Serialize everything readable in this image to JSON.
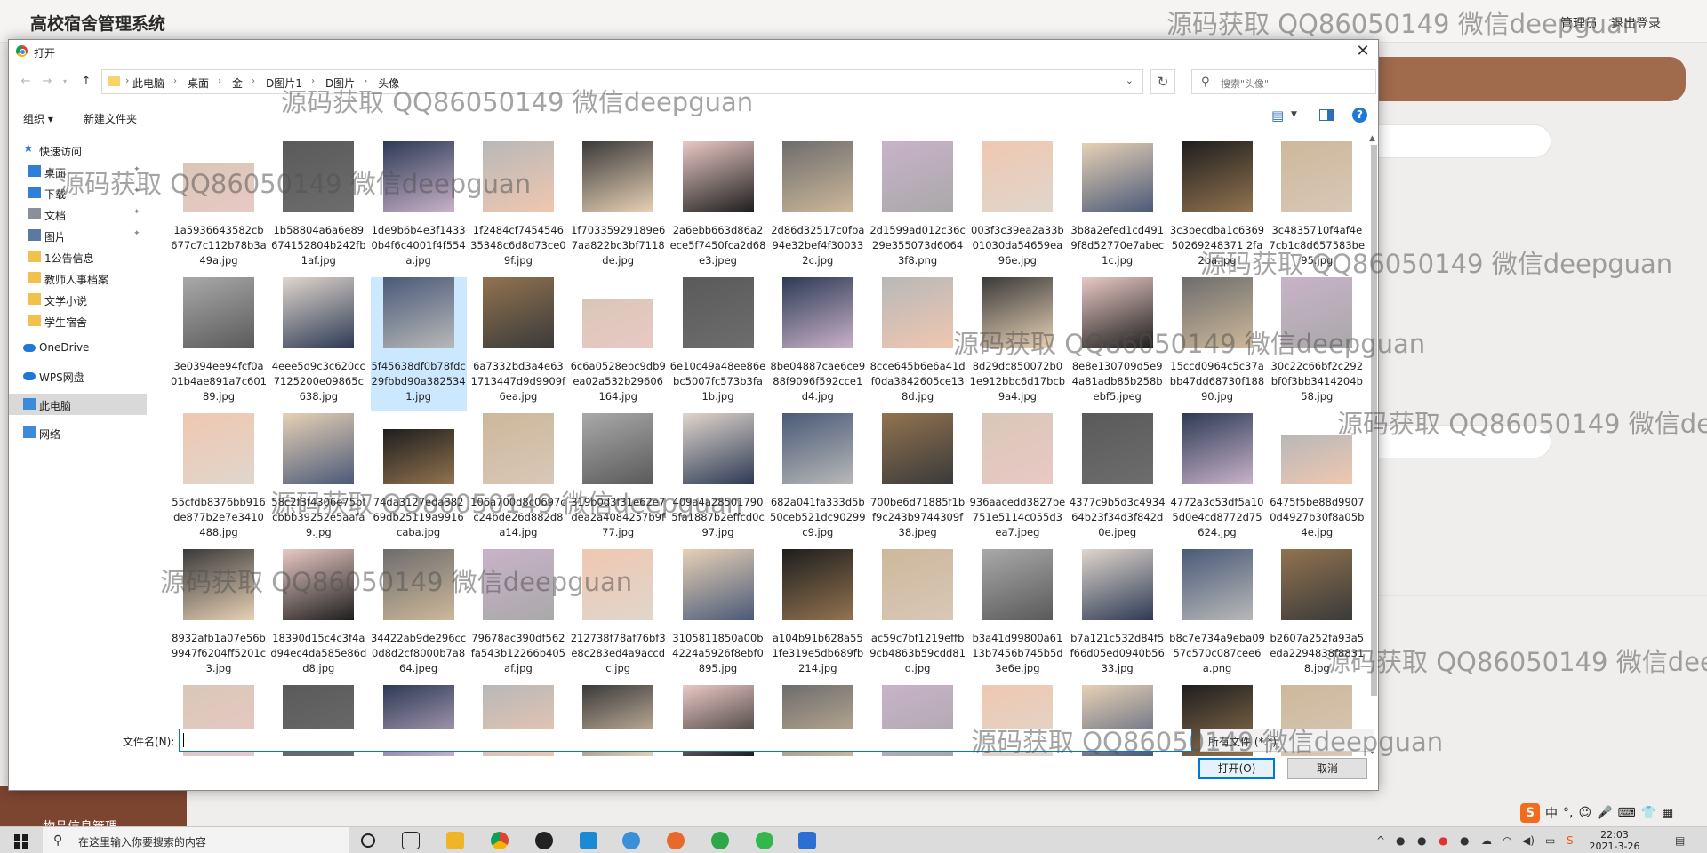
{
  "app": {
    "title": "高校宿舍管理系统",
    "user": "管理员",
    "logout": "退出登录",
    "side_label": "物品信息管理",
    "accent": "#a06a4c"
  },
  "watermark": "源码获取 QQ86050149 微信deepguan",
  "dialog": {
    "title": "打开",
    "close": "✕",
    "breadcrumbs": [
      "此电脑",
      "桌面",
      "金",
      "D图片1",
      "D图片",
      "头像"
    ],
    "search_placeholder": "搜索\"头像\"",
    "toolbar": {
      "organize": "组织 ▾",
      "new_folder": "新建文件夹"
    },
    "nav": [
      {
        "label": "快速访问",
        "icon": "star-icon",
        "pinned": false
      },
      {
        "label": "桌面",
        "icon": "desktop-icon",
        "pinned": true
      },
      {
        "label": "下载",
        "icon": "download-icon",
        "pinned": true
      },
      {
        "label": "文档",
        "icon": "document-icon",
        "pinned": true
      },
      {
        "label": "图片",
        "icon": "picture-icon",
        "pinned": true
      },
      {
        "label": "1公告信息",
        "icon": "folder-icon",
        "pinned": false
      },
      {
        "label": "教师人事档案",
        "icon": "folder-icon",
        "pinned": false
      },
      {
        "label": "文学小说",
        "icon": "folder-icon",
        "pinned": false
      },
      {
        "label": "学生宿舍",
        "icon": "folder-icon",
        "pinned": false
      },
      {
        "label": "OneDrive",
        "icon": "cloud-icon",
        "pinned": false
      },
      {
        "label": "WPS网盘",
        "icon": "cloud-icon",
        "pinned": false
      },
      {
        "label": "此电脑",
        "icon": "computer-icon",
        "pinned": false
      },
      {
        "label": "网络",
        "icon": "network-icon",
        "pinned": false
      }
    ],
    "files": [
      [
        "1a5936643582cb677c7c112b78b3a49a.jpg",
        "1b58804a6a6e89674152804b242fb1af.jpg",
        "1de9b6b4e3f14330b4f6c4001f4f554a.jpg",
        "1f2484cf745454635348c6d8d73ce09f.jpg",
        "1f70335929189e67aa822bc3bf7118de.jpg",
        "2a6ebb663d86a2ece5f7450fca2d68e3.jpeg",
        "2d86d32517c0fba94e32bef4f300332c.jpg",
        "2d1599ad012c36c29e355073d60643f8.png",
        "003f3c39ea2a33b01030da54659ea96e.jpg",
        "3b8a2efed1cd4919f8d52770e7abec1c.jpg",
        "3c3becdba1c636950269248371 2fa2ba.jpg",
        "3c4835710f4af4e7cb1c8d657583be95.jpg"
      ],
      [
        "3e0394ee94fcf0a01b4ae891a7c60189.jpg",
        "4eee5d9c3c620cc7125200e09865c638.jpg",
        "5f45638df0b78fdc29fbbd90a3825341.jpg",
        "6a7332bd3a4e631713447d9d9909f6ea.jpg",
        "6c6a0528ebc9db9ea02a532b29606164.jpg",
        "6e10c49a48ee86ebc5007fc573b3fa1b.jpg",
        "8be04887cae6ce988f9096f592cce1d4.jpg",
        "8cce645b6e6a41df0da3842605ce138d.jpg",
        "8d29dc850072b01e912bbc6d17bcb9a4.jpg",
        "8e8e130709d5e94a81adb85b258bebf5.jpeg",
        "15ccd0964c5c37abb47dd68730f18890.jpg",
        "30c22c66bf2c292bf0f3bb3414204b58.jpg"
      ],
      [
        "55cfdb8376bb916de877b2e7e3410488.jpg",
        "58c2f3f4306e75bfcbbb39252e5aafa9.jpg",
        "74da3127eda38269db25119a9916caba.jpg",
        "106a700d8c0697cc24bde26d882d8a14.jpg",
        "319b0d3f31e62e7dea2a4084257b9f77.jpg",
        "409a4a285017905fa1887b2effcd0c97.jpg",
        "682a041fa333d5b50ceb521dc90299c9.jpg",
        "700be6d71885f1bf9c243b9744309f38.jpeg",
        "936aacedd3827be751e5114c055d3ea7.jpeg",
        "4377c9b5d3c493464b23f34d3f842d0e.jpeg",
        "4772a3c53df5a105d0e4cd8772d75624.jpg",
        "6475f5be88d99070d4927b30f8a05b4e.jpg"
      ],
      [
        "8932afb1a07e56b9947f6204ff5201c3.jpg",
        "18390d15c4c3f4ad94ec4da585e86dd8.jpg",
        "34422ab9de296cc0d8d2cf8000b7a864.jpeg",
        "79678ac390df562fa543b12266b405af.jpg",
        "212738f78af76bf3e8c283ed4a9accdc.jpg",
        "3105811850a00b4224a5926f8ebf0895.jpg",
        "a104b91b628a551fe319e5db689fb214.jpg",
        "ac59c7bf1219effb9cb4863b59cdd81d.jpg",
        "b3a41d99800a6113b7456b745b5d3e6e.jpg",
        "b7a121c532d84f5f66d05ed0940b5633.jpg",
        "b8c7e734a9eba0957c570c087cee6a.png",
        "b2607a252fa93a5eda2294838f88318.jpg"
      ],
      [
        "",
        "",
        "",
        "",
        "",
        "",
        "",
        "",
        "",
        "",
        "",
        ""
      ]
    ],
    "filename_label": "文件名(N):",
    "filename_value": "",
    "filetype": "所有文件 (*.*)",
    "open_label": "打开(O)",
    "cancel_label": "取消"
  },
  "taskbar": {
    "search_text": "在这里输入你要搜索的内容",
    "time": "22:03",
    "date": "2021-3-26"
  },
  "ime": {
    "logo": "S",
    "mode": "中"
  }
}
